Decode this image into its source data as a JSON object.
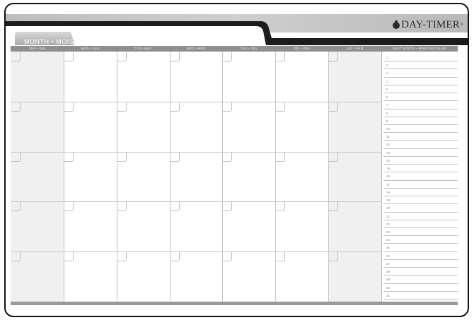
{
  "brand": {
    "name": "DAY-TIMER",
    "trademark": "®"
  },
  "tab": {
    "label": "MONTH • MOIS"
  },
  "days": [
    "SUN • DIM",
    "MON • LUN",
    "TUE • MAR",
    "WED • MER",
    "THU • JEU",
    "FRI • VEN",
    "SAT • SAM"
  ],
  "side": {
    "header": "NEXT MONTH • MOIS PROCHAIN",
    "numbers": [
      "1",
      "2",
      "3",
      "4",
      "5",
      "6",
      "7",
      "8",
      "9",
      "10",
      "11",
      "12",
      "13",
      "14",
      "15",
      "16",
      "17",
      "18",
      "19",
      "20",
      "21",
      "22",
      "23",
      "24",
      "25",
      "26",
      "27",
      "28",
      "29",
      "30",
      "31"
    ]
  },
  "weeks": 5,
  "colors": {
    "header": "#8e8e8e",
    "shaded": "#f0f0f0",
    "frame": "#111111",
    "accent_bar": "#1c1c1c"
  }
}
